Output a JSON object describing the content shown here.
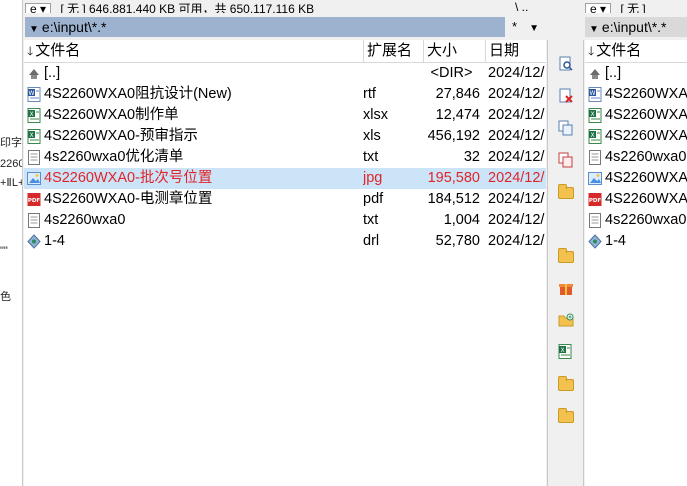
{
  "left_sliver": [
    "印字",
    "2260",
    "+ⅡL+",
    "\"\"",
    "色"
  ],
  "left_panel": {
    "drive": "e",
    "free_space_text": "[ 无 ]  646,881,440 KB 可用，共 650,117,116 KB",
    "path": "e:\\input\\*.*",
    "path_filter": "*",
    "headers": {
      "name": "文件名",
      "ext": "扩展名",
      "size": "大小",
      "date": "日期"
    },
    "files": [
      {
        "name": "[..]",
        "ext": "",
        "size": "<DIR>",
        "date": "2024/12/",
        "icon": "up-dir-icon"
      },
      {
        "name": "4S2260WXA0阻抗设计(New)",
        "ext": "rtf",
        "size": "27,846",
        "date": "2024/12/",
        "icon": "word-doc-icon"
      },
      {
        "name": "4S2260WXA0制作单",
        "ext": "xlsx",
        "size": "12,474",
        "date": "2024/12/",
        "icon": "excel-icon"
      },
      {
        "name": "4S2260WXA0-预审指示",
        "ext": "xls",
        "size": "456,192",
        "date": "2024/12/",
        "icon": "excel-icon"
      },
      {
        "name": "4s2260wxa0优化清单",
        "ext": "txt",
        "size": "32",
        "date": "2024/12/",
        "icon": "text-file-icon"
      },
      {
        "name": "4S2260WXA0-批次号位置",
        "ext": "jpg",
        "size": "195,580",
        "date": "2024/12/",
        "icon": "image-file-icon",
        "selected": true
      },
      {
        "name": "4S2260WXA0-电测章位置",
        "ext": "pdf",
        "size": "184,512",
        "date": "2024/12/",
        "icon": "pdf-icon"
      },
      {
        "name": "4s2260wxa0",
        "ext": "txt",
        "size": "1,004",
        "date": "2024/12/",
        "icon": "text-file-icon"
      },
      {
        "name": "1-4",
        "ext": "drl",
        "size": "52,780",
        "date": "2024/12/",
        "icon": "drl-file-icon"
      }
    ]
  },
  "right_panel": {
    "drive": "e",
    "free_space_text": "[ 无 ]",
    "path": "e:\\input\\*.*",
    "header_name": "文件名",
    "files": [
      {
        "name": "[..]",
        "icon": "up-dir-icon"
      },
      {
        "name": "4S2260WXA0",
        "icon": "word-doc-icon"
      },
      {
        "name": "4S2260WXA0",
        "icon": "excel-icon"
      },
      {
        "name": "4S2260WXA0",
        "icon": "excel-icon"
      },
      {
        "name": "4s2260wxa0优",
        "icon": "text-file-icon"
      },
      {
        "name": "4S2260WXA0",
        "icon": "image-file-icon"
      },
      {
        "name": "4S2260WXA0",
        "icon": "pdf-icon"
      },
      {
        "name": "4s2260wxa0",
        "icon": "text-file-icon"
      },
      {
        "name": "1-4",
        "icon": "drl-file-icon"
      }
    ]
  },
  "middle_top_text": "\\  ..",
  "toolbar_icons": [
    "search-doc-icon",
    "delete-doc-icon",
    "copy-icon",
    "move-icon",
    "folder-icon",
    "folder-icon",
    "gift-icon",
    "new-folder-icon",
    "excel-icon",
    "folder-icon",
    "folder-icon"
  ],
  "colors": {
    "selected_bg": "#cce4f7",
    "selected_text": "#e0242a",
    "path_bar": "#9db2cf"
  }
}
